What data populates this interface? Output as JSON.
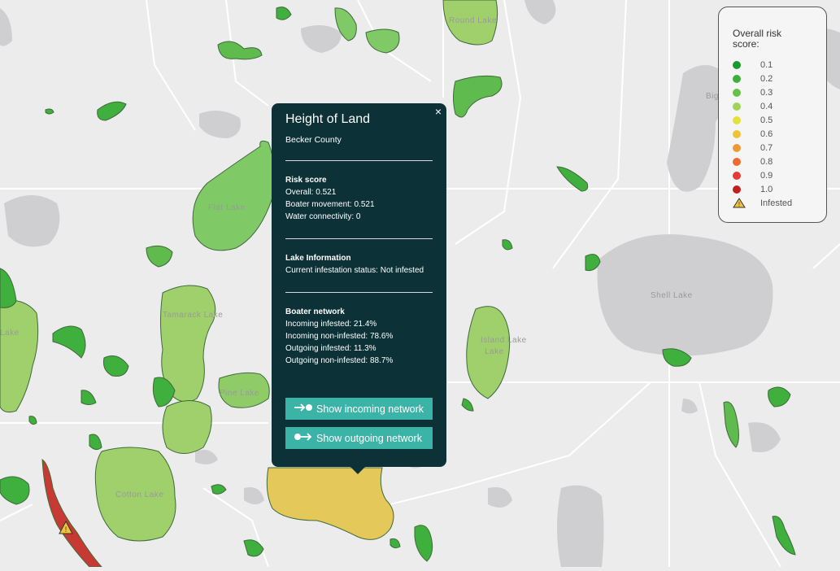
{
  "map": {
    "labels": [
      "Island Lake",
      "Flat Lake",
      "Tamarack Lake",
      "Pine Lake",
      "Cotton Lake",
      "Shell Lake",
      "Round Lake",
      "Big",
      "Lake",
      "Lake"
    ],
    "colors": {
      "low": "#2e9e3e",
      "mid_green": "#5fbb4e",
      "light_green": "#9fd06b",
      "yellow": "#e4c85a",
      "red": "#c73a33",
      "water_gray": "#cfcfd2"
    }
  },
  "popup": {
    "close": "×",
    "title": "Height of Land",
    "county": "Becker County",
    "risk": {
      "heading": "Risk score",
      "overall": "Overall: 0.521",
      "boater": "Boater movement: 0.521",
      "water": "Water connectivity: 0"
    },
    "lake": {
      "heading": "Lake Information",
      "status": "Current infestation status: Not infested"
    },
    "network": {
      "heading": "Boater network",
      "in_inf": "Incoming infested: 21.4%",
      "in_non": "Incoming non-infested: 78.6%",
      "out_inf": "Outgoing infested: 11.3%",
      "out_non": "Outgoing non-infested: 88.7%"
    },
    "btn_in": "Show incoming network",
    "btn_out": "Show outgoing network"
  },
  "legend": {
    "title": "Overall risk score:",
    "items": [
      {
        "label": "0.1",
        "color": "#1a9a2c"
      },
      {
        "label": "0.2",
        "color": "#3fae3a"
      },
      {
        "label": "0.3",
        "color": "#66c24a"
      },
      {
        "label": "0.4",
        "color": "#9fd458"
      },
      {
        "label": "0.5",
        "color": "#e3e23a"
      },
      {
        "label": "0.6",
        "color": "#f0c23a"
      },
      {
        "label": "0.7",
        "color": "#ee9a34"
      },
      {
        "label": "0.8",
        "color": "#ed6a32"
      },
      {
        "label": "0.9",
        "color": "#e63a34"
      },
      {
        "label": "1.0",
        "color": "#c01f1f"
      }
    ],
    "infested": "Infested"
  }
}
